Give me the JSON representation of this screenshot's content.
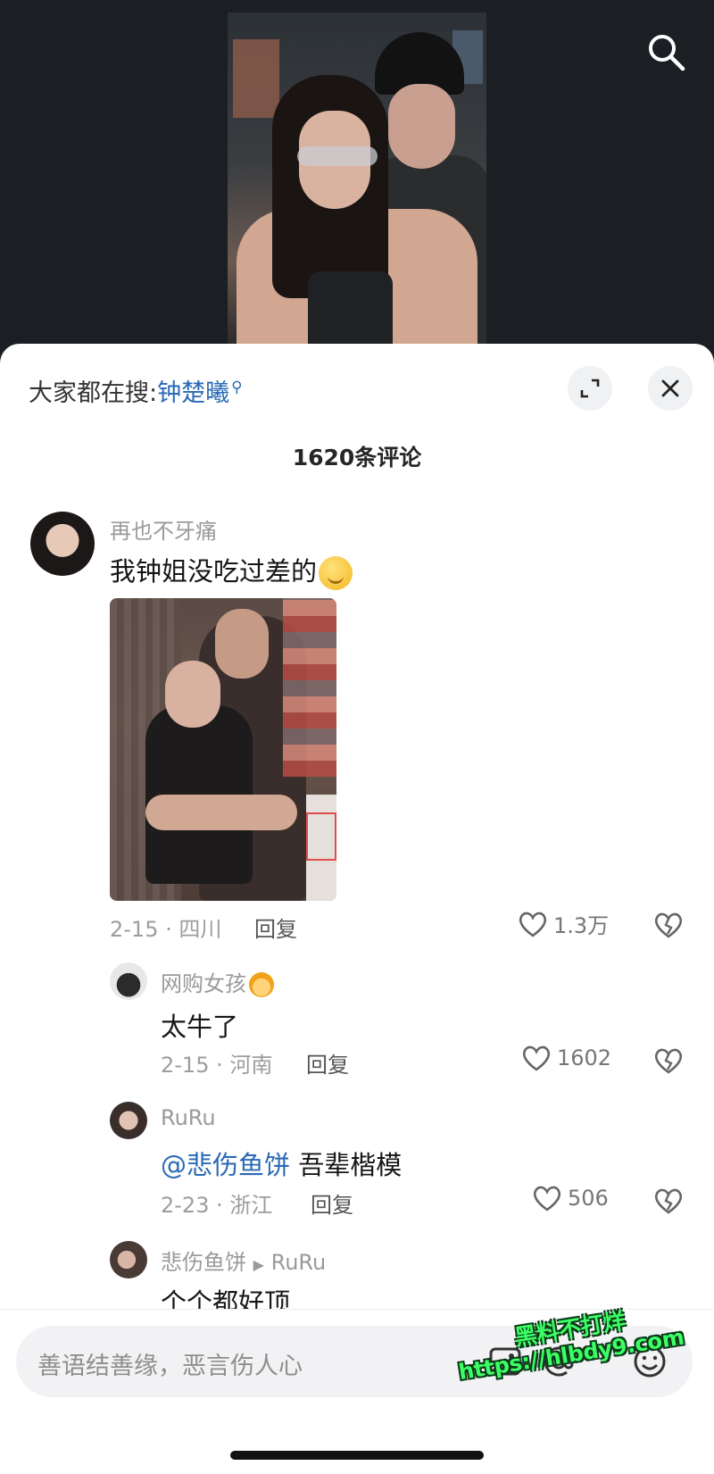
{
  "hot_search": {
    "prefix": "大家都在搜:",
    "keyword": "钟楚曦"
  },
  "comment_count_title": "1620条评论",
  "comments": [
    {
      "username": "再也不牙痛",
      "text": "我钟姐没吃过差的",
      "emoji": "smirk-emoji",
      "has_image": true,
      "date_location": "2-15 · 四川",
      "reply_label": "回复",
      "likes": "1.3万"
    },
    {
      "username": "网购女孩",
      "name_emoji": "girl-emoji",
      "text": "太牛了",
      "date_location": "2-15 · 河南",
      "reply_label": "回复",
      "likes": "1602"
    },
    {
      "username": "RuRu",
      "mention": "@悲伤鱼饼",
      "text": "吾辈楷模",
      "date_location": "2-23 · 浙江",
      "reply_label": "回复",
      "likes": "506"
    },
    {
      "username": "悲伤鱼饼",
      "reply_to": "RuRu",
      "text": "个个都好顶"
    }
  ],
  "input": {
    "placeholder": "善语结善缘，恶言伤人心"
  },
  "watermark": {
    "line1": "黑料不打烊",
    "line2": "https://hlbdy9.com"
  },
  "colors": {
    "link": "#2a6ab5",
    "meta": "#9d9d9d",
    "watermark": "#3cff64"
  }
}
